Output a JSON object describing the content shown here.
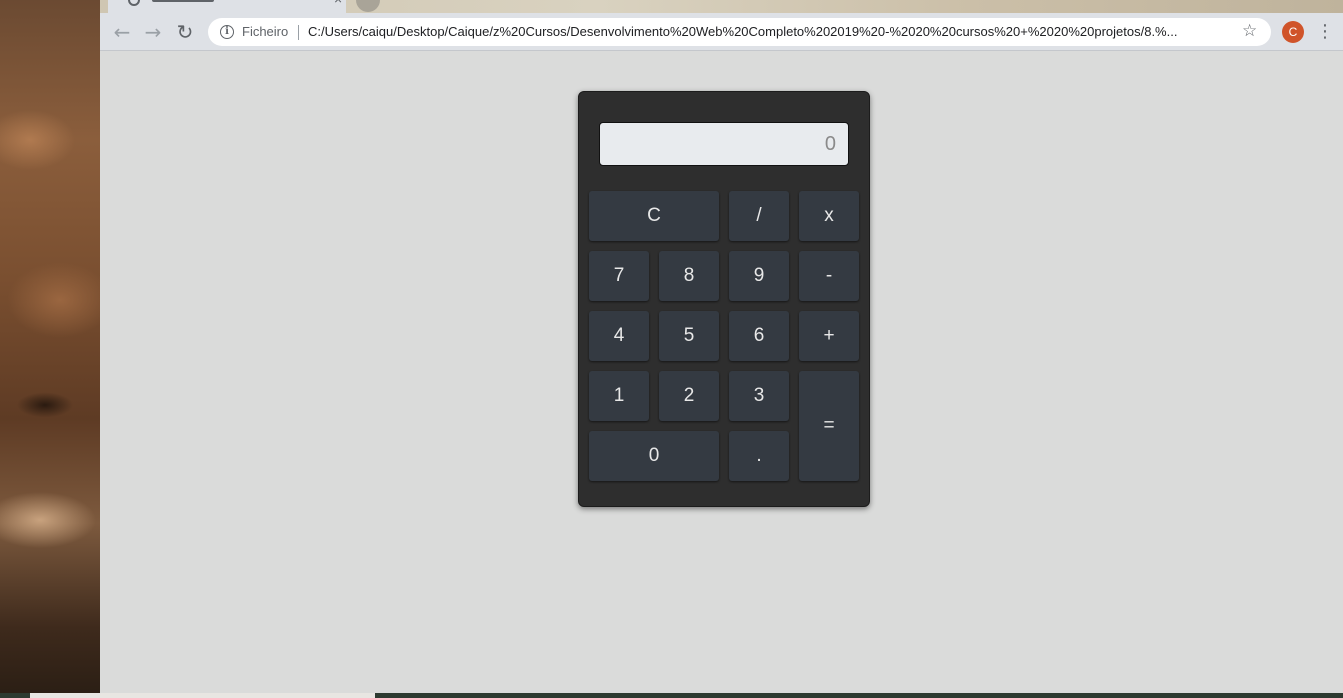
{
  "browser": {
    "security_label": "Ficheiro",
    "url": "C:/Users/caiqu/Desktop/Caique/z%20Cursos/Desenvolvimento%20Web%20Completo%202019%20-%2020%20cursos%20+%2020%20projetos/8.%...",
    "profile_initial": "C",
    "icons": {
      "back": "arrow-left-icon",
      "forward": "arrow-right-icon",
      "reload": "reload-icon",
      "info": "info-icon",
      "bookmark": "star-icon",
      "menu": "more-vert-icon"
    },
    "profile_color": "#d0542a"
  },
  "calculator": {
    "display_value": "0",
    "keys": {
      "clear": "C",
      "divide": "/",
      "multiply": "x",
      "seven": "7",
      "eight": "8",
      "nine": "9",
      "subtract": "-",
      "four": "4",
      "five": "5",
      "six": "6",
      "add": "+",
      "one": "1",
      "two": "2",
      "three": "3",
      "equals": "=",
      "zero": "0",
      "decimal": "."
    },
    "colors": {
      "body": "#2e2e2e",
      "key": "#343a42",
      "display": "#e8ebee"
    }
  }
}
